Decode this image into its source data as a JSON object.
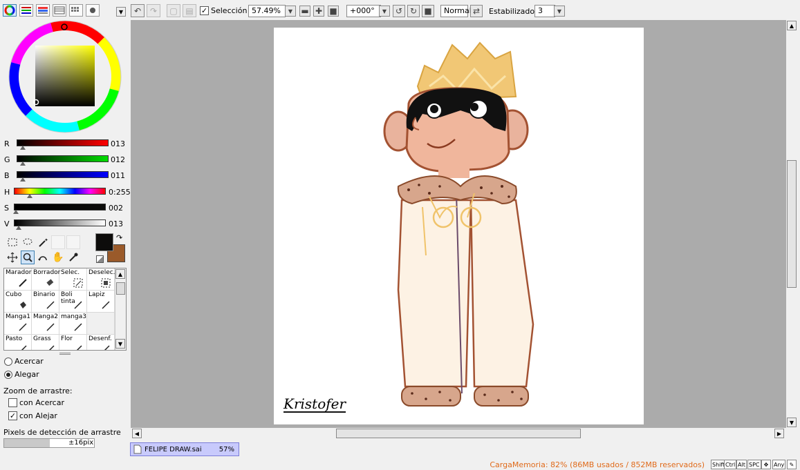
{
  "toolbar": {
    "selection_label": "Selección",
    "zoom": "57.49%",
    "rotation": "+000°",
    "blend_mode": "Normal",
    "stabilizer_label": "Estabilizador",
    "stabilizer_value": "3"
  },
  "color": {
    "r": "013",
    "g": "012",
    "b": "011",
    "h": "0:255",
    "s": "002",
    "v": "013",
    "labels": {
      "r": "R",
      "g": "G",
      "b": "B",
      "h": "H",
      "s": "S",
      "v": "V"
    },
    "primary": "#0d0c0b",
    "secondary": "#9a5a2a"
  },
  "brushes": [
    "Marador",
    "Borrador",
    "Selec.",
    "Deselec.",
    "Cubo",
    "Binario",
    "Boli tinta",
    "Lapiz",
    "Manga1",
    "Manga2",
    "manga3",
    "",
    "Pasto",
    "Grass",
    "Flor",
    "Desenf."
  ],
  "zoom_options": {
    "zoom_in": "Acercar",
    "zoom_out": "Alegar",
    "drag_zoom_label": "Zoom de arrastre:",
    "with_zoom_in": "con Acercar",
    "with_zoom_out": "con Alejar",
    "drag_pixels_label": "Pixels de detección de arrastre",
    "drag_pixels_value": "±16pix"
  },
  "canvas": {
    "signature": "Kristofer"
  },
  "file_tab": {
    "name": "FELIPE DRAW.sai",
    "zoom": "57%"
  },
  "status": {
    "memory": "CargaMemoria: 82% (86MB usados / 852MB reservados)"
  },
  "keys": [
    "Shift",
    "Ctrl",
    "Alt",
    "SPC",
    "Any"
  ]
}
